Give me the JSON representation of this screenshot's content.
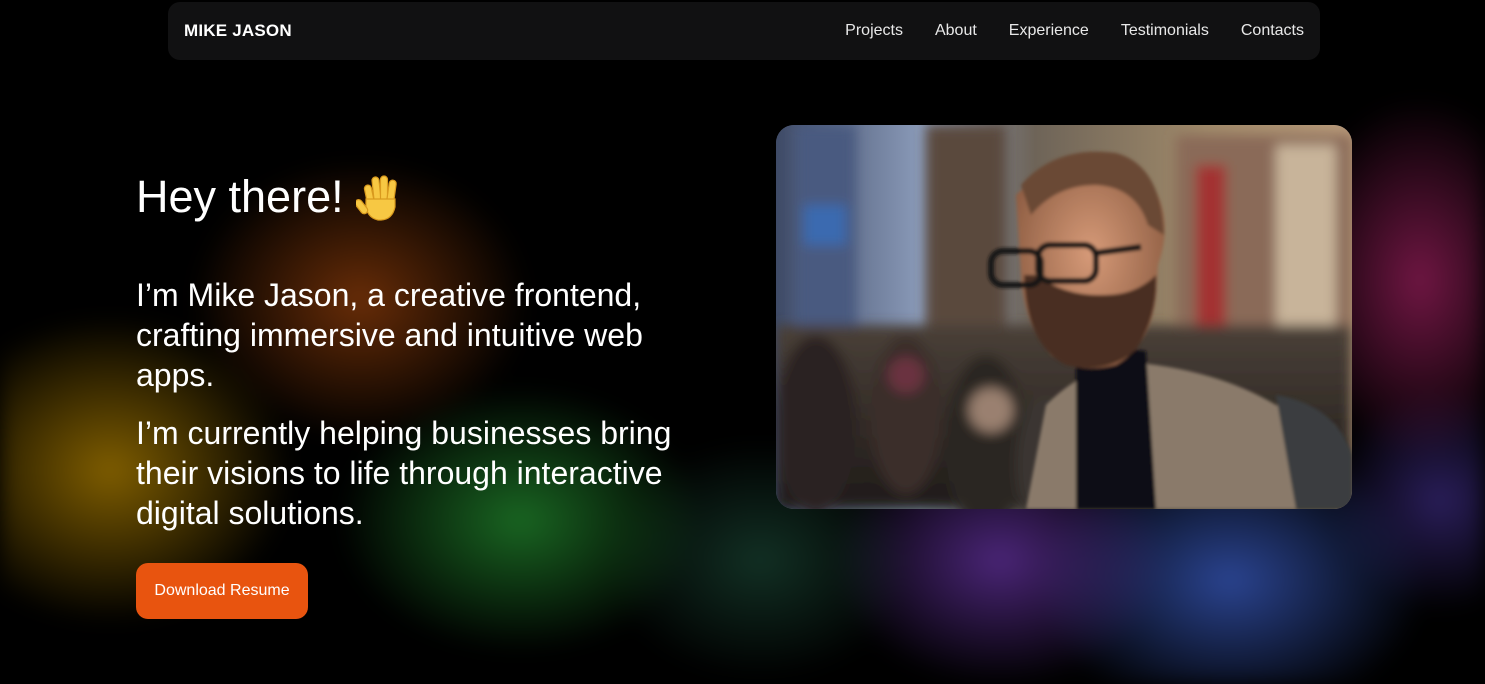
{
  "nav": {
    "brand": "MIKE JASON",
    "links": [
      "Projects",
      "About",
      "Experience",
      "Testimonials",
      "Contacts"
    ]
  },
  "hero": {
    "greeting": "Hey there!",
    "greeting_icon": "waving-hand-icon",
    "intro": "I’m Mike Jason, a creative frontend, crafting immersive and intuitive web apps.",
    "current": "I’m currently helping businesses bring their visions to life through interactive digital solutions.",
    "cta_label": "Download Resume"
  },
  "colors": {
    "accent": "#e8540f",
    "background": "#000000",
    "navbar": "#121214"
  }
}
